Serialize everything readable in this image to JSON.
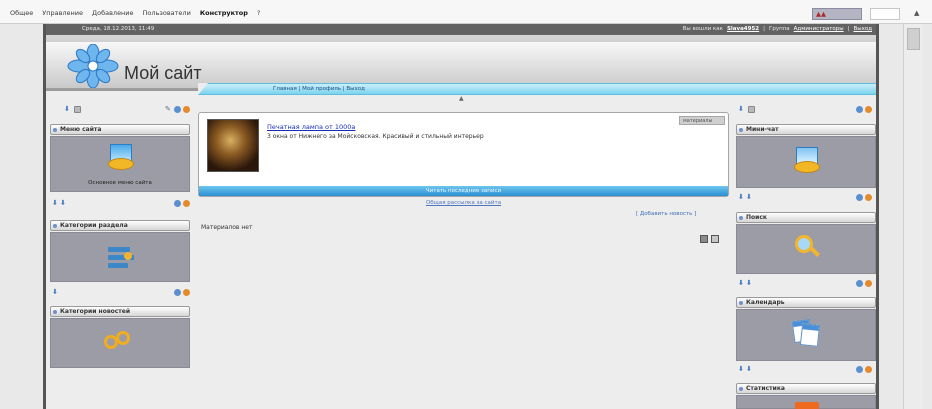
{
  "topmenu": {
    "items": [
      "Общее",
      "Управление",
      "Добавление",
      "Пользователи",
      "Конструктор",
      "?"
    ],
    "active_index": 4
  },
  "site": {
    "date": "Среда, 18.12.2013, 11:49",
    "greeting": "Вы вошли как",
    "user": "Slava4952",
    "group_label": "Группа",
    "group": "Администраторы",
    "logout": "Выход",
    "title": "Мой сайт",
    "nav": "Главная | Мой профиль | Выход"
  },
  "left_blocks": [
    {
      "title": "Меню сайта",
      "caption": "Основное меню сайта"
    },
    {
      "title": "Категории раздела",
      "caption": ""
    },
    {
      "title": "Категории новостей",
      "caption": ""
    }
  ],
  "right_blocks": [
    {
      "title": "Мини-чат"
    },
    {
      "title": "Поиск"
    },
    {
      "title": "Календарь"
    },
    {
      "title": "Статистика"
    }
  ],
  "content": {
    "entry_title": "Печатная лампа от 1000а",
    "entry_desc": "3 окна от Нижнего за Мойсковская. Красивый и стильный интерьер",
    "entry_tag": "материалы",
    "footer": "Читать последние записи",
    "all_link": "Общая рассылка за сайта",
    "add_entry": "[ Добавить новость ]",
    "no_materials": "Материалов нет"
  },
  "colors": {
    "accent": "#2b8fd0",
    "nav_light": "#cbeefa",
    "userbar": "#636363",
    "block_body": "#9c9ca6"
  }
}
